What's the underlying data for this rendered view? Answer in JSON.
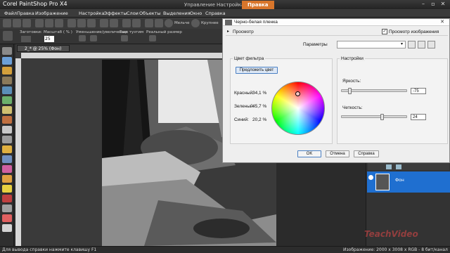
{
  "app": {
    "title": "Corel PaintShop Pro X4",
    "tabs": [
      {
        "label": "Управление",
        "active": false
      },
      {
        "label": "Настройка",
        "active": false
      },
      {
        "label": "Правка",
        "active": true
      }
    ]
  },
  "menu": [
    "Файл",
    "Правка",
    "Изображение",
    "Настройка",
    "Эффекты",
    "Слои",
    "Объекты",
    "Выделения",
    "Окно",
    "Справка"
  ],
  "toolbar": {
    "zoom_in_label": "Крупнее",
    "zoom_out_label": "Мельче"
  },
  "tool_options": {
    "presets": "Заготовки:",
    "zoom_label": "Масштаб ( % )",
    "zoom_value": "25",
    "zoom_step": "Уменьшение/увеличение:",
    "more": "Еще тузтим",
    "actual_size": "Реальный размер"
  },
  "document": {
    "tab_label": "2_* @ 25% (Фон)"
  },
  "layers": {
    "layer_name": "Фон"
  },
  "status": {
    "hint": "Для вывода справки нажмите клавишу F1",
    "info": "Изображение: 2000 x 3008 x RGB - 8 бит/канал"
  },
  "watermark": "TeachVideo",
  "dialog": {
    "title": "Черно-белая пленка",
    "preview_label": "Просмотр",
    "preview_image_label": "Просмотр изображения",
    "preview_image_checked": true,
    "params_label": "Параметры",
    "filter_title": "Цвет фильтра",
    "suggest_button": "Предложить цвет",
    "red_label": "Красный:",
    "red_value": "34,1 %",
    "green_label": "Зеленый:",
    "green_value": "45,7 %",
    "blue_label": "Синий:",
    "blue_value": "20,2 %",
    "settings_title": "Настройки",
    "brightness_label": "Яркость:",
    "brightness_value": "-75",
    "brightness_level": -75,
    "sharpness_label": "Четкость:",
    "sharpness_value": "24",
    "sharpness_level": 24,
    "ok_label": "OK",
    "cancel_label": "Отмена",
    "help_label": "Справка"
  },
  "colors": {
    "accent": "#d9762b",
    "selection": "#1f6fd0"
  }
}
